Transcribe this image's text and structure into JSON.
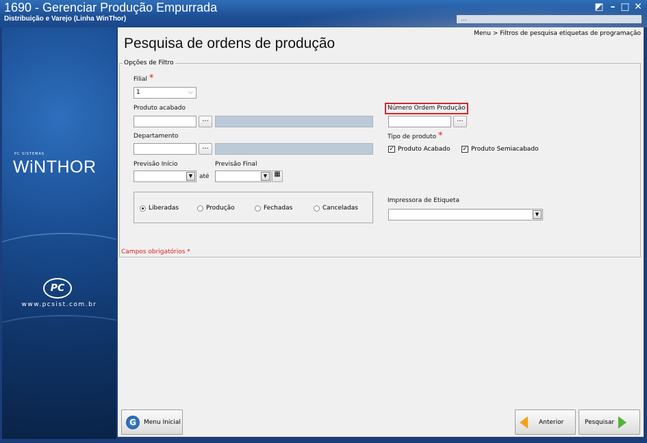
{
  "window": {
    "title": "1690 - Gerenciar Produção Empurrada",
    "subtitle": "Distribuição e Varejo (Linha WinThor)",
    "user_info": "...",
    "controls": {
      "restore": "◩",
      "minimize": "–",
      "maximize": "□",
      "close": "✕"
    }
  },
  "sidebar": {
    "brand_small": "PC SISTEMAS",
    "brand": "WiNTHOR",
    "logo_text": "PC",
    "url": "www.pcsist.com.br"
  },
  "breadcrumb": "Menu > Filtros de pesquisa etiquetas de programação",
  "page_title": "Pesquisa de ordens de produção",
  "filter_group": {
    "legend": "Opções de Filtro",
    "filial": {
      "label": "Filial",
      "value": "1",
      "required_mark": "*"
    },
    "produto_acabado": {
      "label": "Produto acabado",
      "value": "",
      "browse": "..."
    },
    "departamento": {
      "label": "Departamento",
      "value": "",
      "browse": "..."
    },
    "previsao_inicio": {
      "label": "Previsão Início",
      "value": ""
    },
    "ate_label": "até",
    "previsao_final": {
      "label": "Previsão Final",
      "value": ""
    },
    "numero_ordem": {
      "label": "Número Ordem Produção",
      "value": "",
      "browse": "..."
    },
    "tipo_produto": {
      "label": "Tipo de produto",
      "required_mark": "*",
      "options": [
        {
          "label": "Produto Acabado",
          "checked": true
        },
        {
          "label": "Produto Semiacabado",
          "checked": true
        }
      ]
    },
    "status_options": [
      {
        "label": "Liberadas",
        "selected": true
      },
      {
        "label": "Produção",
        "selected": false
      },
      {
        "label": "Fechadas",
        "selected": false
      },
      {
        "label": "Canceladas",
        "selected": false
      }
    ],
    "impressora": {
      "label": "Impressora de Etiqueta",
      "value": ""
    },
    "required_note": "Campos obrigatórios",
    "required_note_mark": "*"
  },
  "buttons": {
    "menu_inicial": "Menu Inicial",
    "anterior": "Anterior",
    "pesquisar": "Pesquisar"
  },
  "colors": {
    "accent": "#1d4f95",
    "highlight": "#d6232a",
    "required": "#e01a1a",
    "disabled_field": "#bccad8"
  }
}
